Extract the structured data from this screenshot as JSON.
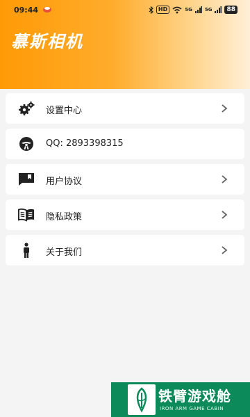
{
  "status_bar": {
    "time": "09:44",
    "hd_badge": "HD",
    "signal_1": "5G",
    "signal_2": "5G",
    "battery": "88"
  },
  "header": {
    "app_title": "慕斯相机"
  },
  "menu": {
    "items": [
      {
        "label": "设置中心",
        "icon": "gears-icon",
        "has_chevron": true
      },
      {
        "label": "QQ: 2893398315",
        "icon": "steering-wheel-icon",
        "has_chevron": false
      },
      {
        "label": "用户协议",
        "icon": "message-icon",
        "has_chevron": true
      },
      {
        "label": "隐私政策",
        "icon": "book-icon",
        "has_chevron": true
      },
      {
        "label": "关于我们",
        "icon": "person-icon",
        "has_chevron": true
      }
    ]
  },
  "watermark": {
    "title": "铁臂游戏舱",
    "subtitle": "IRON ARM GAME CABIN"
  },
  "colors": {
    "header_start": "#ff9a06",
    "header_end": "#ffefd8",
    "background": "#f4f4f4",
    "watermark_green": "#0c8a5a"
  }
}
